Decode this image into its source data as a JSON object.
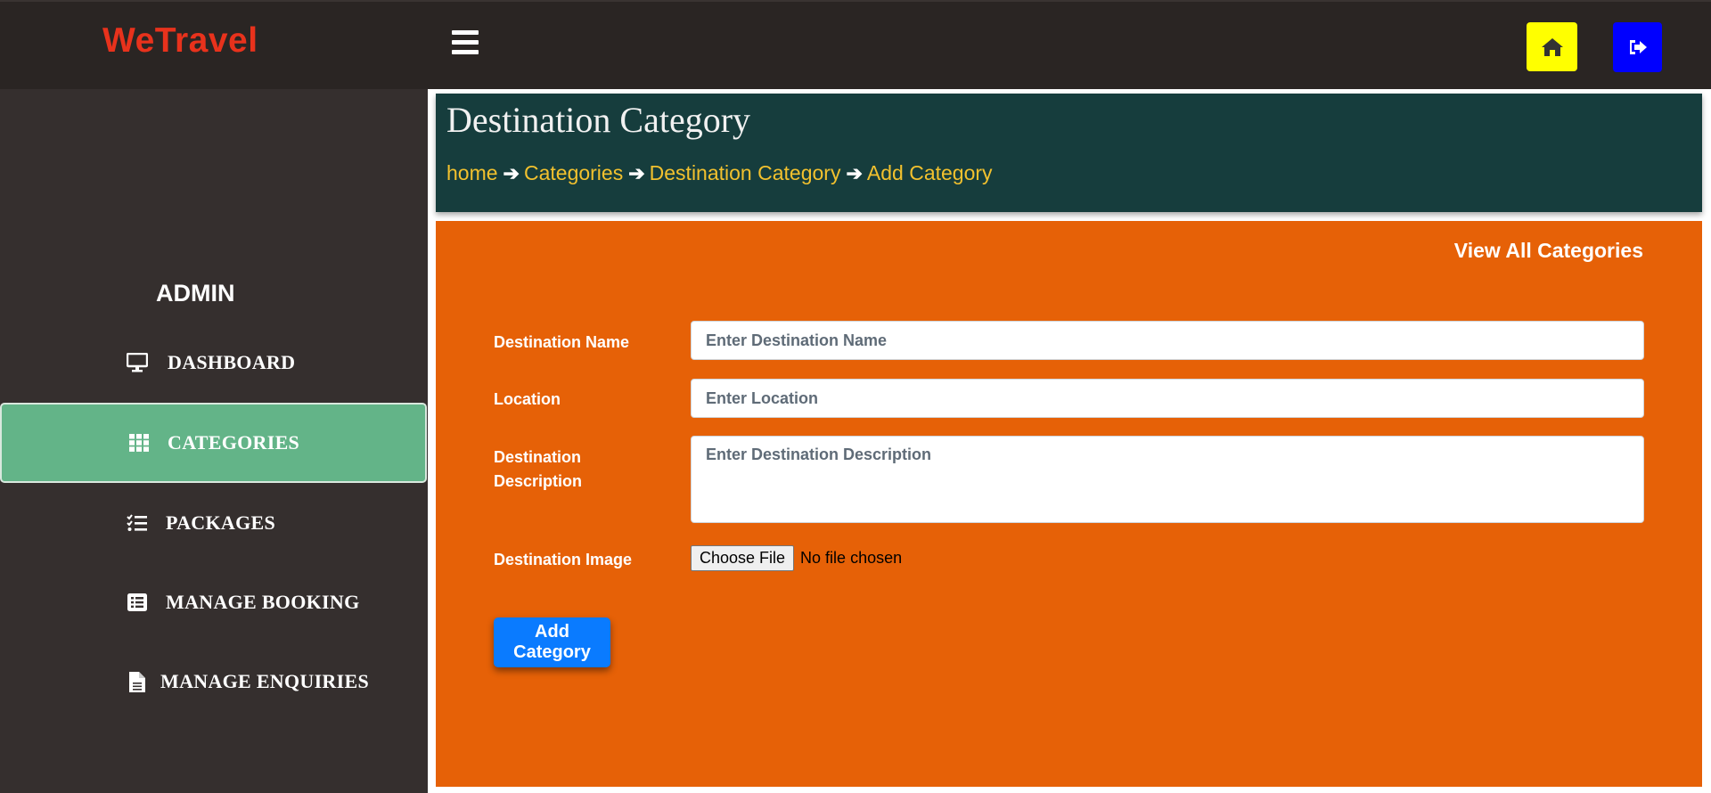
{
  "brand": {
    "name": "WeTravel",
    "color": "#e8321c"
  },
  "topbar": {
    "menu_icon": "hamburger-icon",
    "home_icon": "home-icon",
    "logout_icon": "sign-out-icon",
    "home_color": "#ffff00",
    "logout_color": "#0000ff"
  },
  "sidebar": {
    "heading": "ADMIN",
    "items": [
      {
        "label": "DASHBOARD",
        "icon": "desktop-icon",
        "active": false
      },
      {
        "label": "CATEGORIES",
        "icon": "grid-icon",
        "active": true
      },
      {
        "label": "PACKAGES",
        "icon": "checklist-icon",
        "active": false
      },
      {
        "label": "MANAGE BOOKING",
        "icon": "list-icon",
        "active": false
      },
      {
        "label": "MANAGE ENQUIRIES",
        "icon": "file-icon",
        "active": false
      }
    ],
    "active_color": "#63b488"
  },
  "header": {
    "title": "Destination Category",
    "breadcrumb": [
      "home",
      "Categories",
      "Destination Category",
      "Add Category"
    ]
  },
  "form": {
    "view_all_link": "View All Categories",
    "fields": {
      "name": {
        "label": "Destination Name",
        "placeholder": "Enter Destination Name",
        "value": ""
      },
      "location": {
        "label": "Location",
        "placeholder": "Enter Location",
        "value": ""
      },
      "description": {
        "label_line1": "Destination",
        "label_line2": "Description",
        "placeholder": "Enter Destination Description",
        "value": ""
      },
      "image": {
        "label": "Destination Image",
        "button": "Choose File",
        "status": "No file chosen"
      }
    },
    "submit_label": "Add Category",
    "panel_color": "#e66107"
  }
}
